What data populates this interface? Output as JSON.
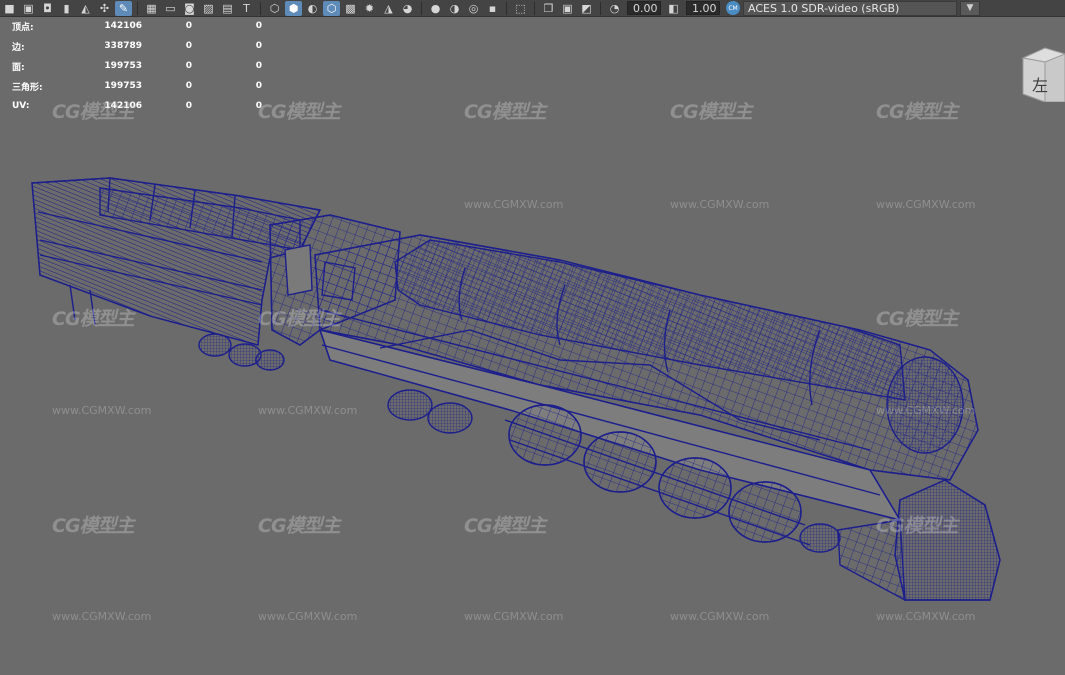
{
  "toolbar": {
    "exposure_value": "0.00",
    "gamma_value": "1.00",
    "color_mgmt_badge": "CM",
    "color_space": "ACES 1.0 SDR-video (sRGB)",
    "icons": [
      "camera-icon",
      "camera-attr-icon",
      "bookmark-icon",
      "image-plane-icon",
      "grid-icon",
      "film-gate-icon",
      "resolution-gate-icon",
      "safe-area-icon",
      "text-icon",
      "wireframe-icon",
      "smooth-shade-icon",
      "shade-all-icon",
      "wireframe-on-shaded-icon",
      "textured-icon",
      "lights-icon",
      "shadows-icon",
      "screen-space-ao-icon",
      "motion-blur-icon",
      "isolate-icon",
      "xray-icon",
      "xray-joints-icon",
      "backface-icon",
      "exposure-icon",
      "gamma-icon"
    ]
  },
  "hud": {
    "rows": [
      {
        "label": "顶点:",
        "v1": "142106",
        "v2": "0",
        "v3": "0"
      },
      {
        "label": "边:",
        "v1": "338789",
        "v2": "0",
        "v3": "0"
      },
      {
        "label": "面:",
        "v1": "199753",
        "v2": "0",
        "v3": "0"
      },
      {
        "label": "三角形:",
        "v1": "199753",
        "v2": "0",
        "v3": "0"
      },
      {
        "label": "UV:",
        "v1": "142106",
        "v2": "0",
        "v3": "0"
      }
    ]
  },
  "viewcube": {
    "face_label": "左"
  },
  "watermark": {
    "logo": "CG模型主",
    "url": "www.CGMXW.com"
  },
  "colors": {
    "viewport_bg": "#6b6b6b",
    "wireframe": "#1c1f8c",
    "toolbar_bg": "#444444",
    "active_icon": "#5e8bb7"
  }
}
